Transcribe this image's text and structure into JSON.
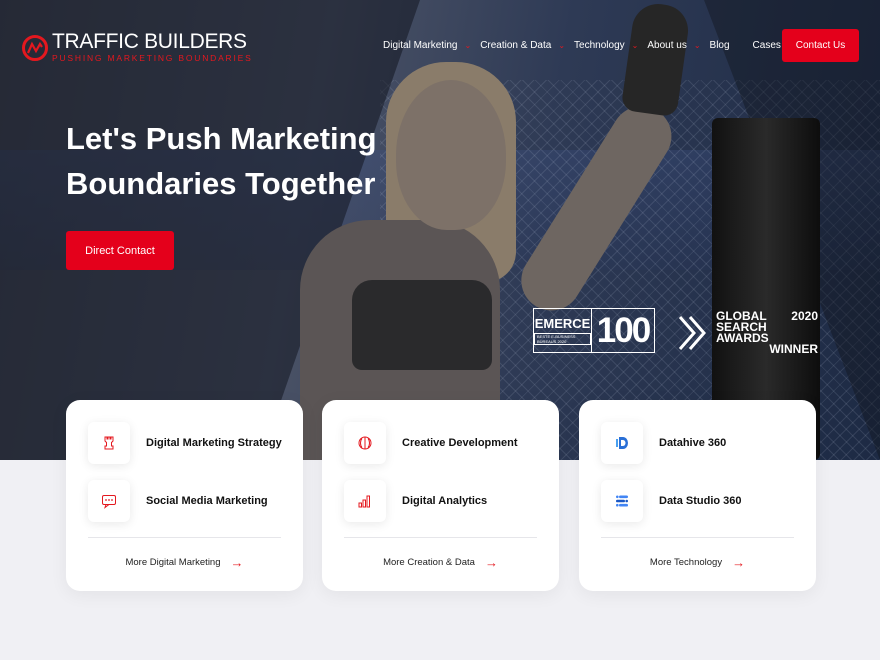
{
  "brand": {
    "title": "TRAFFIC BUILDERS",
    "tagline": "PUSHING MARKETING BOUNDARIES",
    "accent": "#e4001b"
  },
  "nav": {
    "items": [
      {
        "label": "Digital Marketing",
        "dropdown": true
      },
      {
        "label": "Creation & Data",
        "dropdown": true
      },
      {
        "label": "Technology",
        "dropdown": true
      },
      {
        "label": "About us",
        "dropdown": true
      },
      {
        "label": "Blog",
        "dropdown": false
      },
      {
        "label": "Cases",
        "dropdown": false
      }
    ],
    "contact_label": "Contact Us"
  },
  "hero": {
    "headline_line1": "Let's Push Marketing",
    "headline_line2": "Boundaries Together",
    "cta_label": "Direct Contact"
  },
  "awards": {
    "emerce_name": "EMERCE",
    "emerce_sub": "BESTE E-BUSINESS BUREAUS 2020",
    "emerce_number": "100",
    "global_line1_a": "GLOBAL",
    "global_line1_b": "2020",
    "global_line2": "SEARCH AWARDS",
    "global_line3": "WINNER"
  },
  "cards": [
    {
      "items": [
        {
          "icon": "chess-rook-icon",
          "label": "Digital Marketing Strategy"
        },
        {
          "icon": "chat-bubble-icon",
          "label": "Social Media Marketing"
        }
      ],
      "more_label": "More Digital Marketing"
    },
    {
      "items": [
        {
          "icon": "creative-circle-icon",
          "label": "Creative Development"
        },
        {
          "icon": "bar-chart-icon",
          "label": "Digital Analytics"
        }
      ],
      "more_label": "More Creation & Data"
    },
    {
      "items": [
        {
          "icon": "datahive-icon",
          "label": "Datahive 360"
        },
        {
          "icon": "data-studio-icon",
          "label": "Data Studio 360"
        }
      ],
      "more_label": "More Technology"
    }
  ]
}
